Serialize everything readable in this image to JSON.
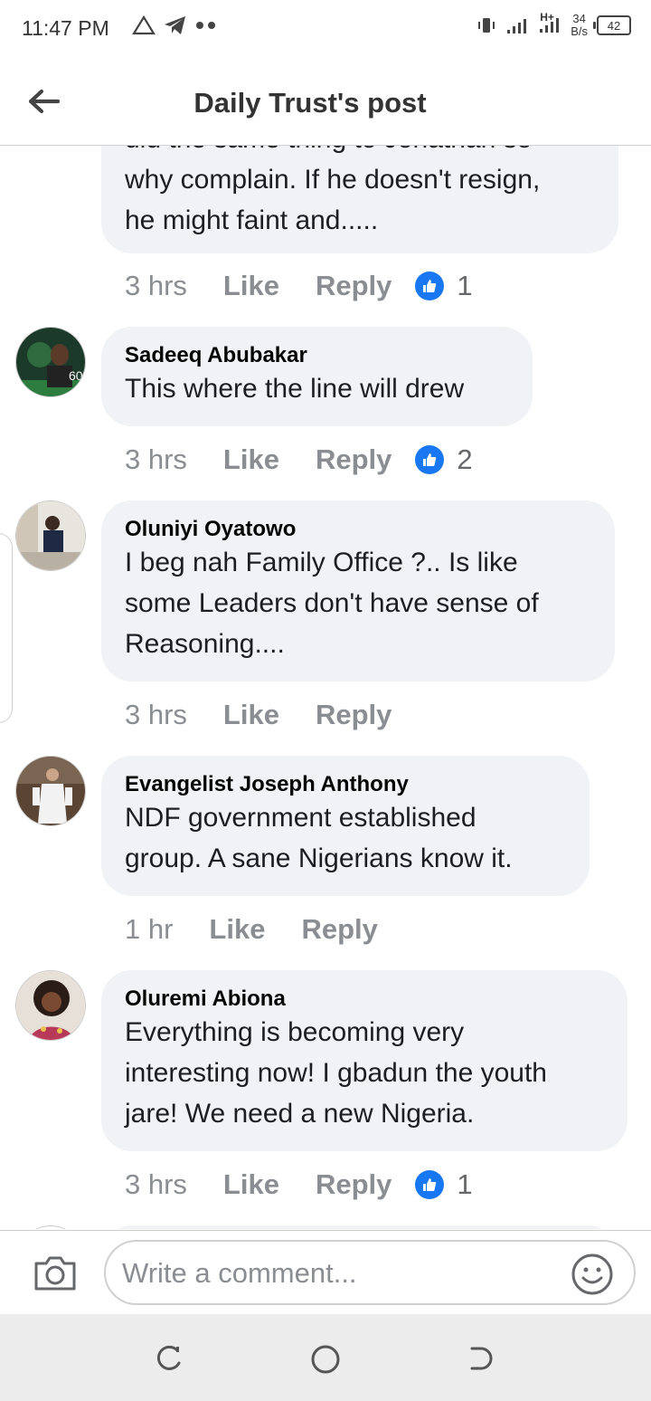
{
  "status_bar": {
    "time": "11:47 PM",
    "net_speed_value": "34",
    "net_speed_unit": "B/s",
    "network_type": "H+",
    "battery": "42"
  },
  "header": {
    "title": "Daily Trust's post"
  },
  "comments": [
    {
      "author": "",
      "lines": [
        "did the same thing to Jonathan so",
        "why complain. If he doesn't resign,",
        "he might faint and....."
      ],
      "time": "3 hrs",
      "like_label": "Like",
      "reply_label": "Reply",
      "reactions": "1"
    },
    {
      "author": "Sadeeq Abubakar",
      "lines": [
        "This where the line will drew"
      ],
      "time": "3 hrs",
      "like_label": "Like",
      "reply_label": "Reply",
      "reactions": "2"
    },
    {
      "author": "Oluniyi Oyatowo",
      "lines": [
        "I beg nah Family Office ?.. Is like",
        "some Leaders don't have sense of",
        "Reasoning...."
      ],
      "time": "3 hrs",
      "like_label": "Like",
      "reply_label": "Reply",
      "reactions": ""
    },
    {
      "author": "Evangelist Joseph Anthony",
      "lines": [
        "NDF government established",
        "group. A sane Nigerians know it."
      ],
      "time": "1 hr",
      "like_label": "Like",
      "reply_label": "Reply",
      "reactions": ""
    },
    {
      "author": "Oluremi Abiona",
      "lines": [
        "Everything is becoming very",
        "interesting now! I gbadun the youth",
        "jare! We need a new Nigeria."
      ],
      "time": "3 hrs",
      "like_label": "Like",
      "reply_label": "Reply",
      "reactions": "1"
    }
  ],
  "composer": {
    "placeholder": "Write a comment..."
  },
  "colors": {
    "bubble": "#f0f2f5",
    "like_blue": "#1877f2",
    "meta_gray": "#8a8d91"
  }
}
